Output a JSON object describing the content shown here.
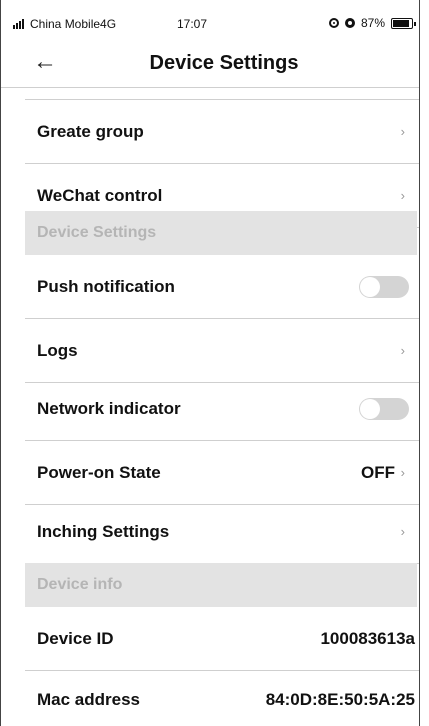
{
  "status_bar": {
    "carrier": "China Mobile4G",
    "time": "17:07",
    "battery_percent": "87%",
    "battery_level": 87
  },
  "header": {
    "title": "Device Settings",
    "back_icon": "arrow-left-icon"
  },
  "rows": {
    "create_group": {
      "label": "Greate group"
    },
    "wechat_control": {
      "label": "WeChat control"
    },
    "push_notification": {
      "label": "Push notification",
      "enabled": false
    },
    "logs": {
      "label": "Logs"
    },
    "network_indicator": {
      "label": "Network indicator",
      "enabled": false
    },
    "power_on_state": {
      "label": "Power-on State",
      "value": "OFF"
    },
    "inching_settings": {
      "label": "Inching Settings"
    },
    "device_id": {
      "label": "Device ID",
      "value": "100083613a"
    },
    "mac_address": {
      "label": "Mac address",
      "value": "84:0D:8E:50:5A:25"
    }
  },
  "sections": {
    "device_settings": "Device Settings",
    "device_info": "Device info"
  },
  "glyphs": {
    "chevron": "›",
    "back": "←"
  },
  "colors": {
    "section_bg": "#e3e3e3",
    "section_text": "#b5b5b5",
    "toggle_off": "#d4d4d4"
  }
}
